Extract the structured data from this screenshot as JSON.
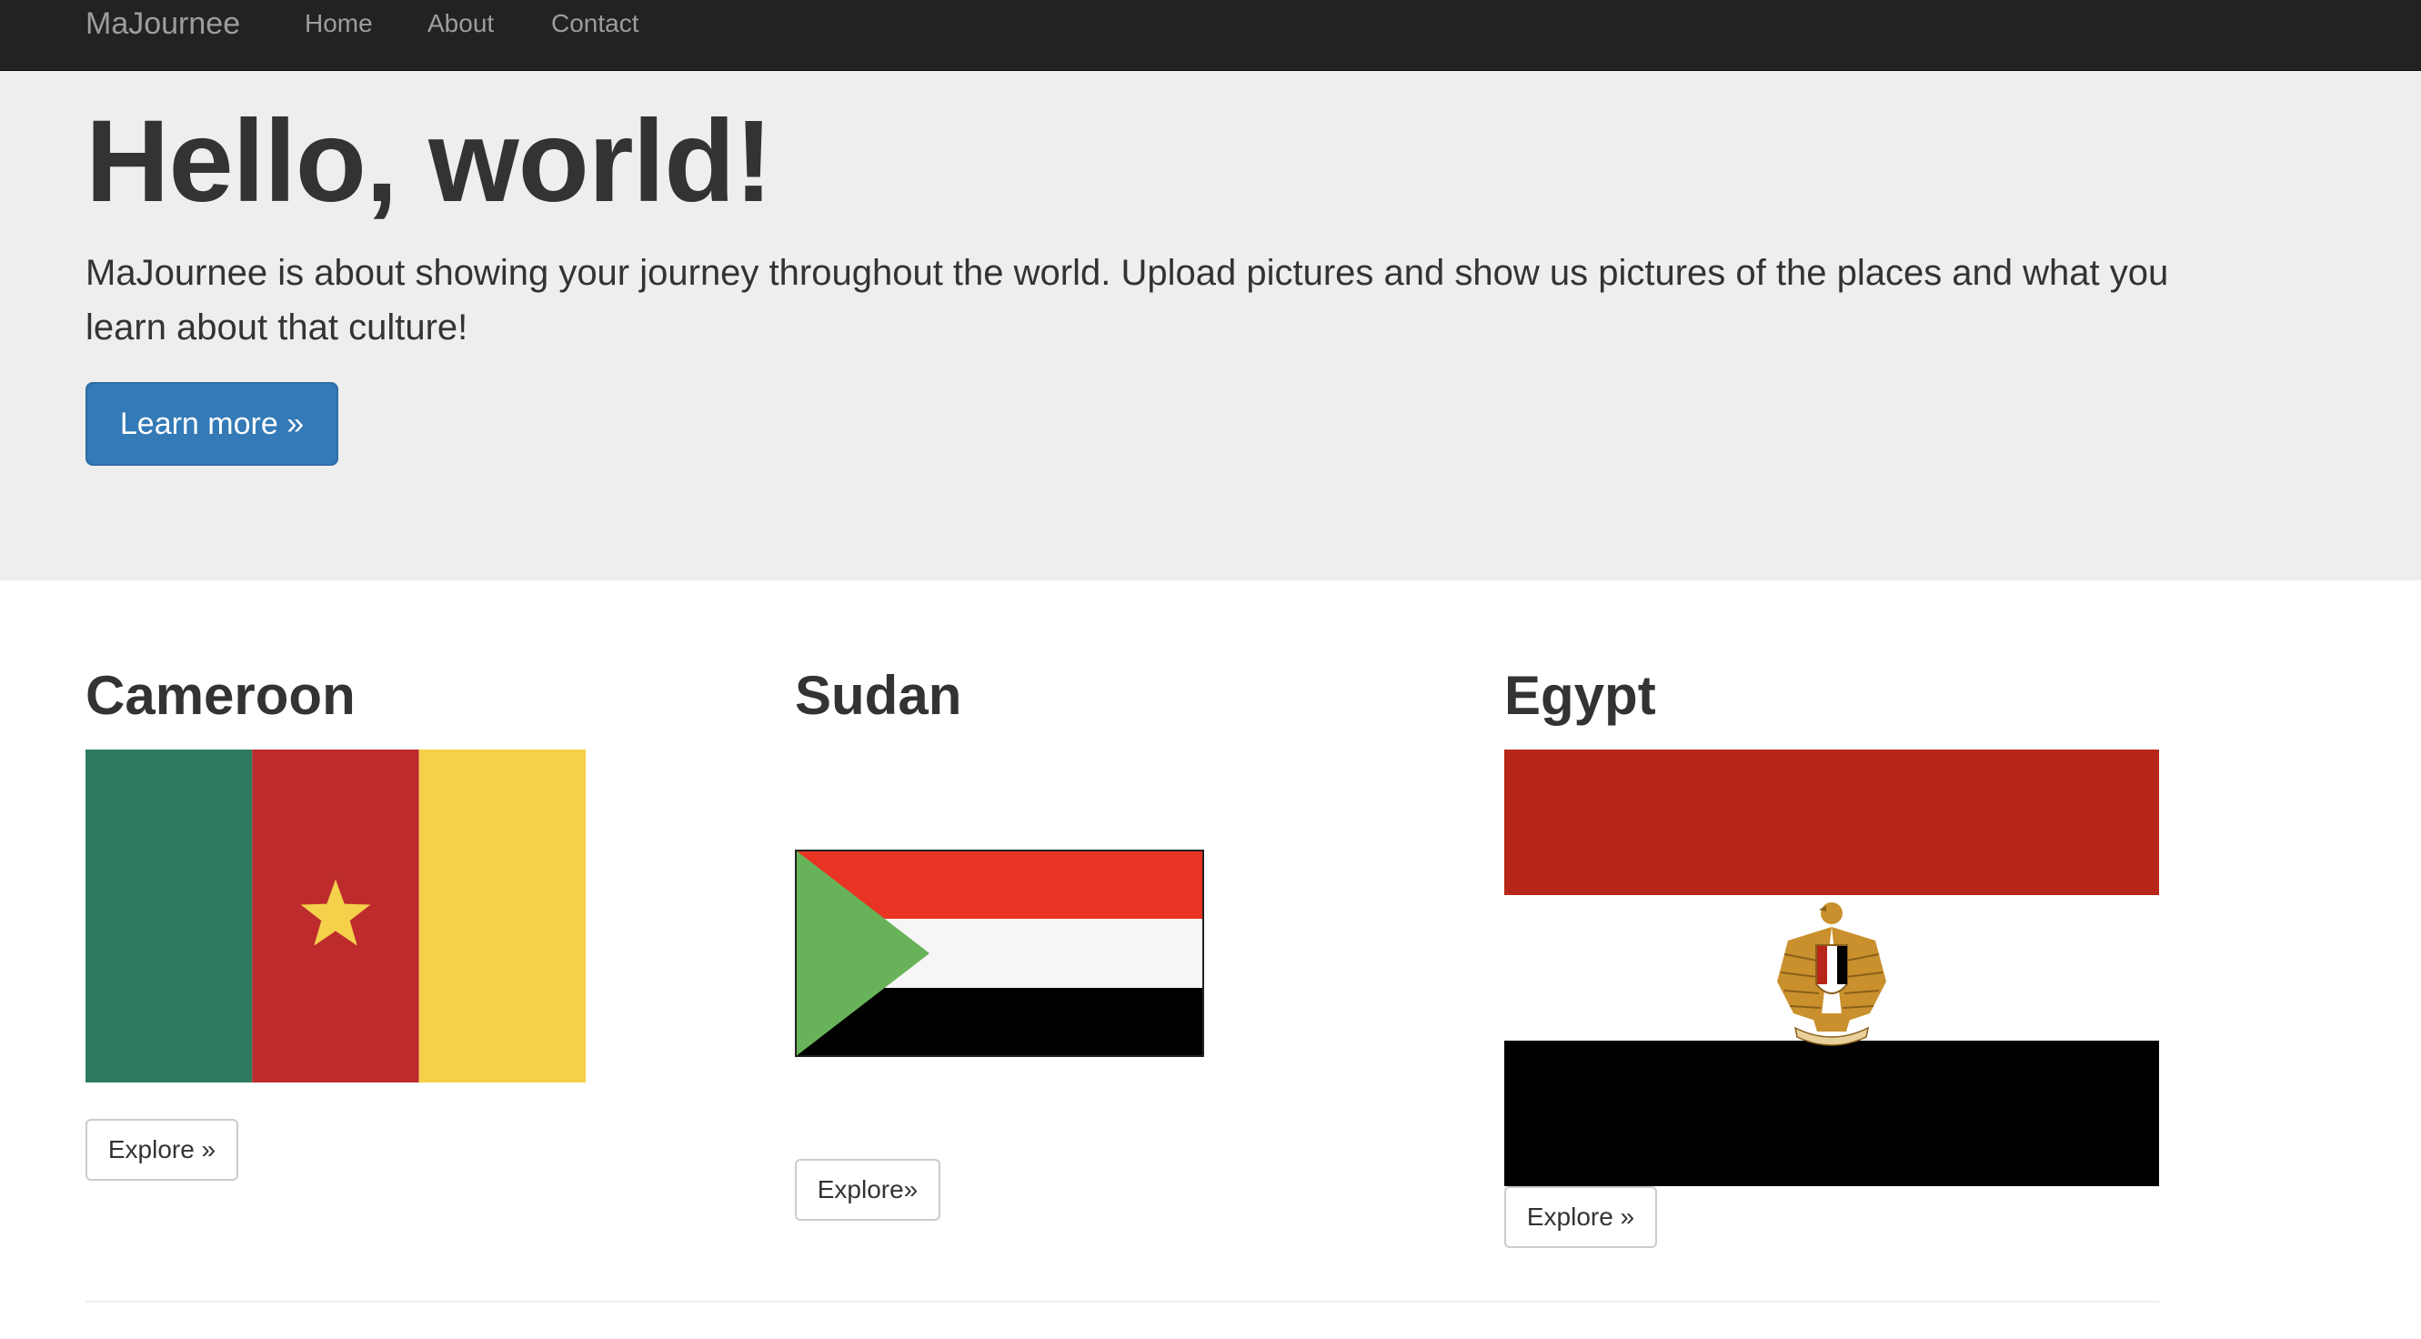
{
  "navbar": {
    "brand": "MaJournee",
    "links": [
      "Home",
      "About",
      "Contact"
    ]
  },
  "hero": {
    "title": "Hello, world!",
    "text": "MaJournee is about showing your journey throughout the world. Upload pictures and show us pictures of the places and what you learn about that culture!",
    "button_label": "Learn more »"
  },
  "countries": [
    {
      "name": "Cameroon",
      "button_label": "Explore »",
      "flag_icon": "cameroon-flag-icon"
    },
    {
      "name": "Sudan",
      "button_label": "Explore»",
      "flag_icon": "sudan-flag-icon"
    },
    {
      "name": "Egypt",
      "button_label": "Explore »",
      "flag_icon": "egypt-flag-icon"
    }
  ],
  "colors": {
    "navbar_bg": "#222222",
    "jumbotron_bg": "#eeeeee",
    "primary": "#337ab7",
    "cameroon_green": "#2f7a5f",
    "cameroon_red": "#bd2b2d",
    "cameroon_yellow": "#f5d04a",
    "sudan_red": "#e93323",
    "sudan_green": "#68b35a",
    "egypt_red": "#b72618",
    "egypt_gold": "#c9902d"
  }
}
